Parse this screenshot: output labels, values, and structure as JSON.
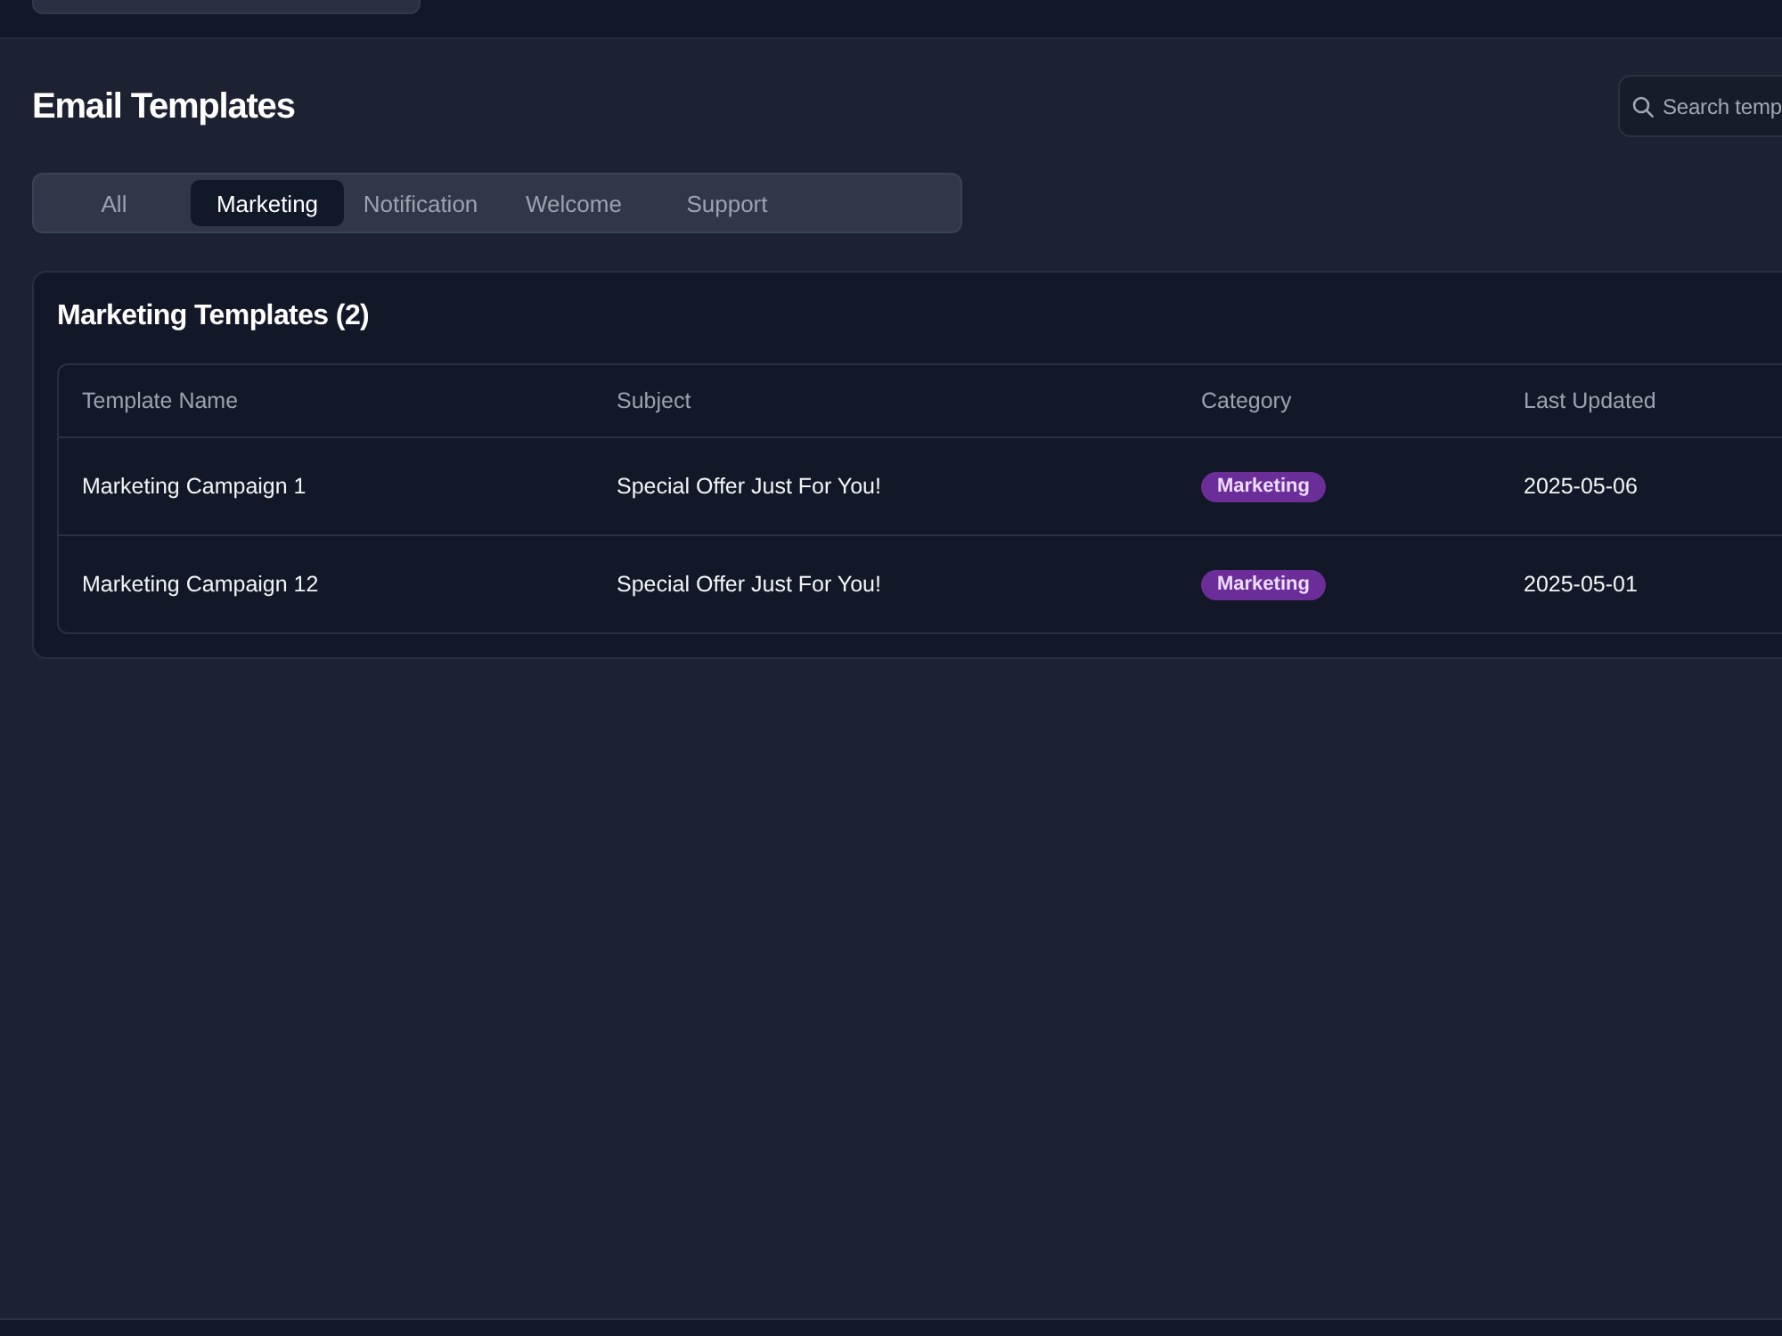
{
  "page": {
    "title": "Email Templates"
  },
  "search": {
    "placeholder": "Search temp"
  },
  "tabs": [
    {
      "label": "All",
      "selected": false
    },
    {
      "label": "Marketing",
      "selected": true
    },
    {
      "label": "Notification",
      "selected": false
    },
    {
      "label": "Welcome",
      "selected": false
    },
    {
      "label": "Support",
      "selected": false
    }
  ],
  "panel": {
    "title": "Marketing Templates (2)",
    "table": {
      "columns": [
        "Template Name",
        "Subject",
        "Category",
        "Last Updated"
      ],
      "rows": [
        {
          "name": "Marketing Campaign 1",
          "subject": "Special Offer Just For You!",
          "category": "Marketing",
          "last_updated": "2025-05-06"
        },
        {
          "name": "Marketing Campaign 12",
          "subject": "Special Offer Just For You!",
          "category": "Marketing",
          "last_updated": "2025-05-01"
        }
      ]
    }
  }
}
